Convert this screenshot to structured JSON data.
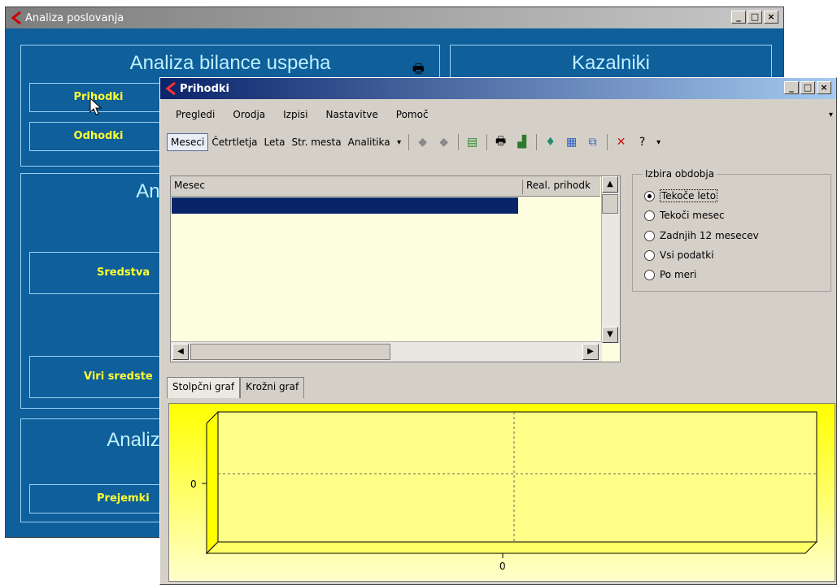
{
  "background_window": {
    "title": "Analiza poslovanja",
    "group1_title": "Analiza bilance uspeha",
    "group1_buttons": [
      "Prihodki",
      "Odhodki"
    ],
    "group2_title": "Kazalniki",
    "group3_title": "Ana",
    "group3_buttons": [
      "Sredstva",
      "Viri sredste"
    ],
    "group4_title": "Analiza",
    "group4_buttons": [
      "Prejemki"
    ]
  },
  "front_window": {
    "title": "Prihodki",
    "menu": [
      "Pregledi",
      "Orodja",
      "Izpisi",
      "Nastavitve",
      "Pomoč"
    ],
    "toolbar_tabs": [
      "Meseci",
      "Četrtletja",
      "Leta",
      "Str. mesta",
      "Analitika"
    ],
    "grid": {
      "columns": [
        "Mesec",
        "Real. prihodk"
      ]
    },
    "period_group": {
      "label": "Izbira obdobja",
      "options": [
        "Tekoče leto",
        "Tekoči mesec",
        "Zadnjih 12 mesecev",
        "Vsi podatki",
        "Po meri"
      ],
      "selected": "Tekoče leto"
    },
    "chart_tabs": [
      "Stolpčni graf",
      "Krožni graf"
    ]
  },
  "chart_data": {
    "type": "bar",
    "categories": [],
    "values": [],
    "ytick": "0",
    "xtick": "0",
    "background_color": "#ffff00"
  },
  "colors": {
    "bg_window": "#0e5f9a",
    "accent_text": "#ffff33",
    "titlebar_active": "#0a246a"
  }
}
